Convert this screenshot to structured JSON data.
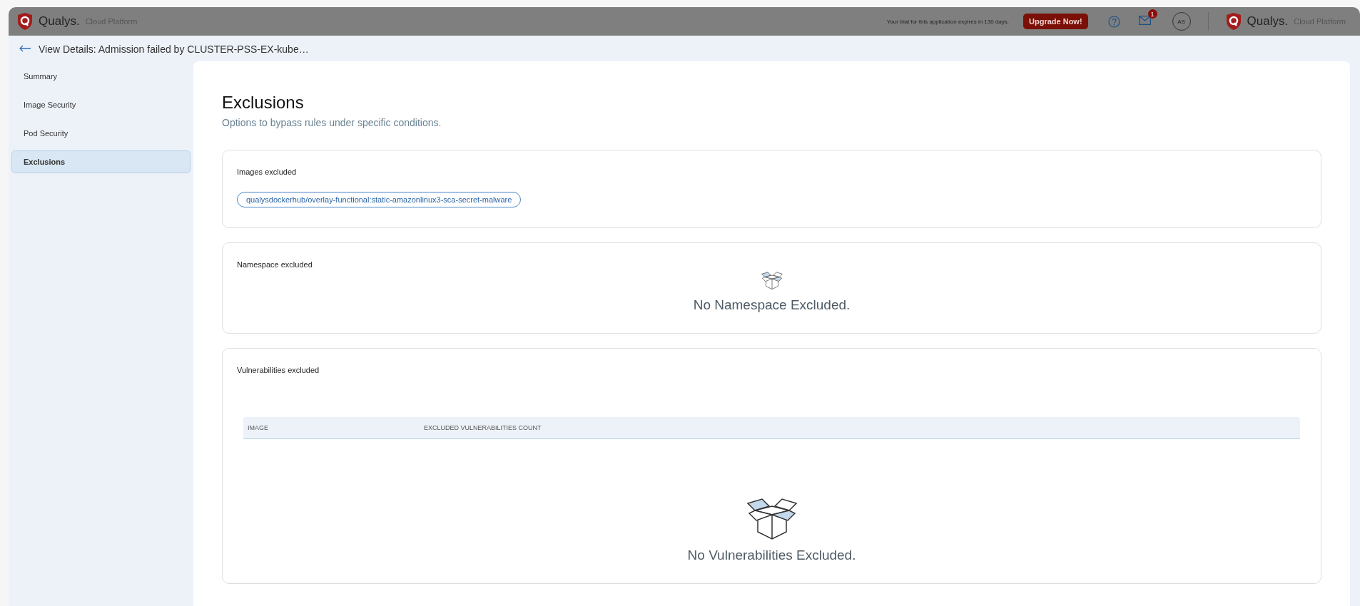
{
  "topbar": {
    "brand": "Qualys.",
    "product": "Cloud Platform",
    "trial_notice": "Your trial for this application expires in 130 days.",
    "upgrade_button": "Upgrade Now!",
    "mail_badge": "1",
    "avatar": "AS",
    "brand_right": "Qualys.",
    "product_right": "Cloud Platform"
  },
  "header": {
    "title": "View Details: Admission failed by CLUSTER-PSS-EX-kube…"
  },
  "sidebar": {
    "items": [
      {
        "label": "Summary",
        "selected": false
      },
      {
        "label": "Image Security",
        "selected": false
      },
      {
        "label": "Pod Security",
        "selected": false
      },
      {
        "label": "Exclusions",
        "selected": true
      }
    ]
  },
  "content": {
    "title": "Exclusions",
    "subtitle": "Options to bypass rules under specific conditions.",
    "sections": [
      {
        "kind": "tags",
        "title": "Images excluded",
        "tags": [
          "qualysdockerhub/overlay-functional:static-amazonlinux3-sca-secret-malware"
        ]
      },
      {
        "kind": "empty",
        "title": "Namespace excluded",
        "empty_text": "No Namespace Excluded."
      },
      {
        "kind": "table",
        "title": "Vulnerabilities excluded",
        "columns": [
          "IMAGE",
          "EXCLUDED VULNERABILITIES COUNT"
        ],
        "empty_text": "No Vulnerabilities Excluded."
      }
    ]
  }
}
